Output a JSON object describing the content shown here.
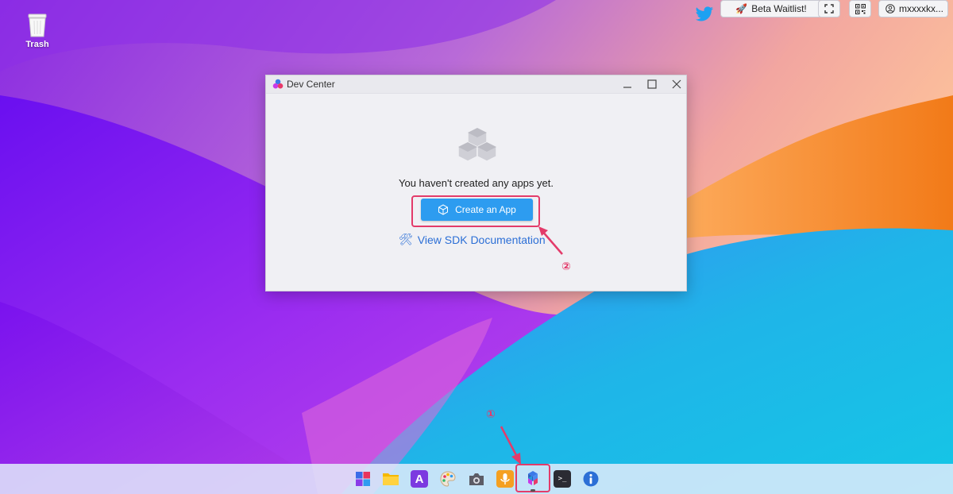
{
  "desktop": {
    "trash_label": "Trash",
    "icons": [
      "trash-icon"
    ]
  },
  "topbar": {
    "beta_label": "Beta Waitlist!",
    "user_label": "mxxxxkx...",
    "icons": [
      "twitter-icon",
      "rocket-icon",
      "fullscreen-icon",
      "qr-code-icon",
      "user-icon"
    ]
  },
  "window": {
    "title": "Dev Center",
    "controls": [
      "minimize-icon",
      "maximize-icon",
      "close-icon"
    ],
    "empty_message": "You haven't created any apps yet.",
    "create_button_label": "Create an App",
    "sdk_link_label": "View SDK Documentation"
  },
  "annotations": {
    "step1": "①",
    "step2": "②"
  },
  "taskbar": {
    "apps": [
      "start-menu-icon",
      "files-icon",
      "text-editor-icon",
      "paint-icon",
      "camera-icon",
      "recorder-icon",
      "dev-center-icon",
      "terminal-icon",
      "info-icon"
    ],
    "active_app": "dev-center-icon"
  },
  "colors": {
    "accent": "#2d9cf0",
    "annotation": "#e33b6a",
    "link": "#2c6fd6"
  }
}
